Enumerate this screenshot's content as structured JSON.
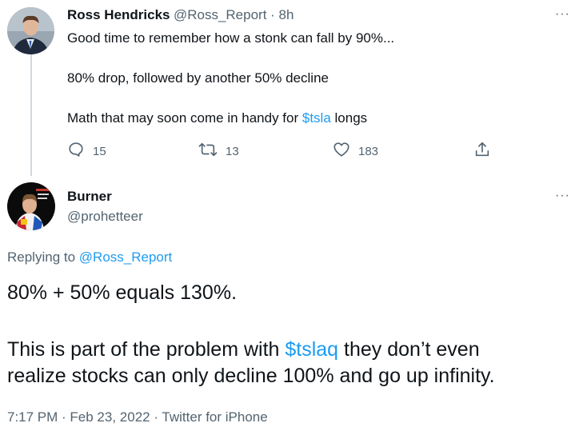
{
  "tweet1": {
    "name": "Ross Hendricks",
    "handle": "@Ross_Report",
    "sep": " · ",
    "time": "8h",
    "line1": "Good time to remember how a stonk can fall by 90%...",
    "line2": "80% drop, followed by another 50% decline",
    "line3_pre": "Math that may soon come in handy for ",
    "line3_link": "$tsla",
    "line3_post": " longs",
    "replies": "15",
    "retweets": "13",
    "likes": "183",
    "more": "···"
  },
  "tweet2": {
    "name": "Burner",
    "handle": "@prohetteer",
    "more": "···",
    "replying_label": "Replying to ",
    "replying_to": "@Ross_Report",
    "line1": "80% + 50% equals 130%.",
    "line2_pre": "This is part of the problem with ",
    "line2_link": "$tslaq",
    "line2_post": " they don’t even",
    "line3": "realize stocks can only decline 100% and go up infinity.",
    "timestamp": "7:17 PM · Feb 23, 2022 · ",
    "source": "Twitter for iPhone"
  },
  "colors": {
    "link": "#1d9bf0",
    "muted": "#536471",
    "text": "#0f1419",
    "thread_line": "#cfd9de"
  },
  "icons": [
    "reply-icon",
    "retweet-icon",
    "like-icon",
    "share-icon",
    "more-icon"
  ]
}
